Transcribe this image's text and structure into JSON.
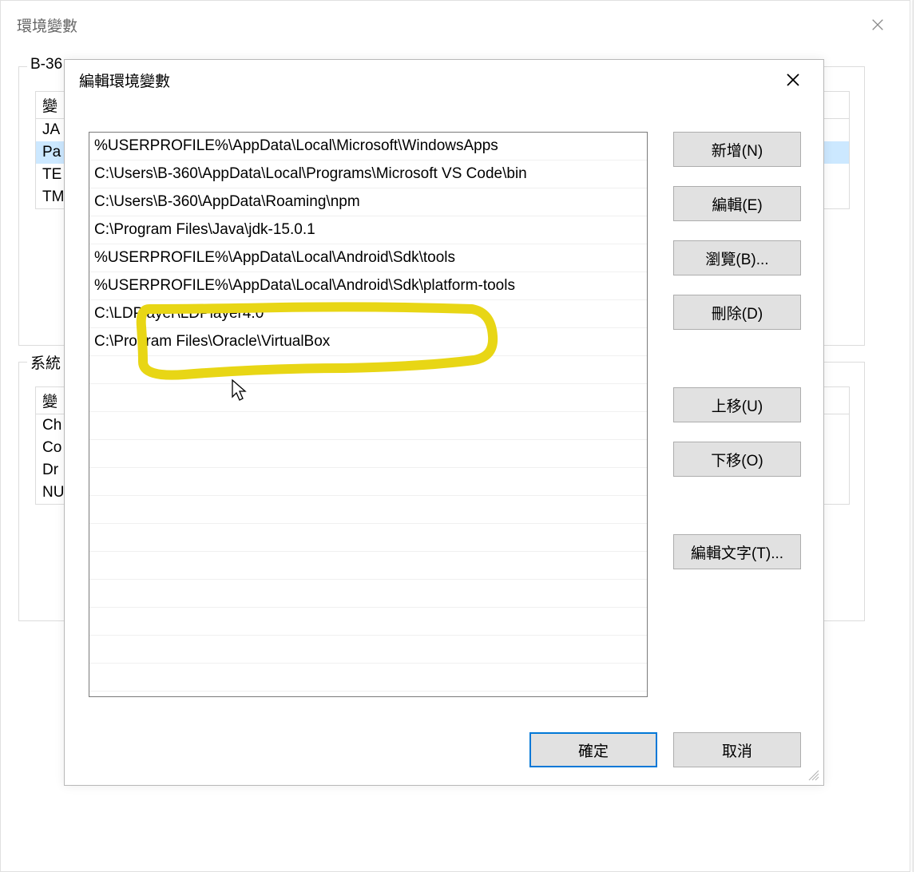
{
  "outer": {
    "title": "環境變數",
    "group1_legend_partial": "B-36",
    "group2_legend_partial": "系統",
    "uservars_header": "變",
    "uservars_rows": [
      "JA",
      "Pa",
      "TE",
      "TM"
    ],
    "sysvars_header": "變",
    "sysvars_rows": [
      "Ch",
      "Co",
      "Dr",
      "NU"
    ]
  },
  "inner": {
    "title": "編輯環境變數",
    "list": [
      "%USERPROFILE%\\AppData\\Local\\Microsoft\\WindowsApps",
      "C:\\Users\\B-360\\AppData\\Local\\Programs\\Microsoft VS Code\\bin",
      "C:\\Users\\B-360\\AppData\\Roaming\\npm",
      "C:\\Program Files\\Java\\jdk-15.0.1",
      "%USERPROFILE%\\AppData\\Local\\Android\\Sdk\\tools",
      "%USERPROFILE%\\AppData\\Local\\Android\\Sdk\\platform-tools",
      "C:\\LDPlayer\\LDPlayer4.0",
      "C:\\Program Files\\Oracle\\VirtualBox"
    ],
    "buttons": {
      "new": "新增(N)",
      "edit": "編輯(E)",
      "browse": "瀏覽(B)...",
      "delete": "刪除(D)",
      "moveup": "上移(U)",
      "movedown": "下移(O)",
      "edittext": "編輯文字(T)..."
    },
    "ok": "確定",
    "cancel": "取消"
  }
}
